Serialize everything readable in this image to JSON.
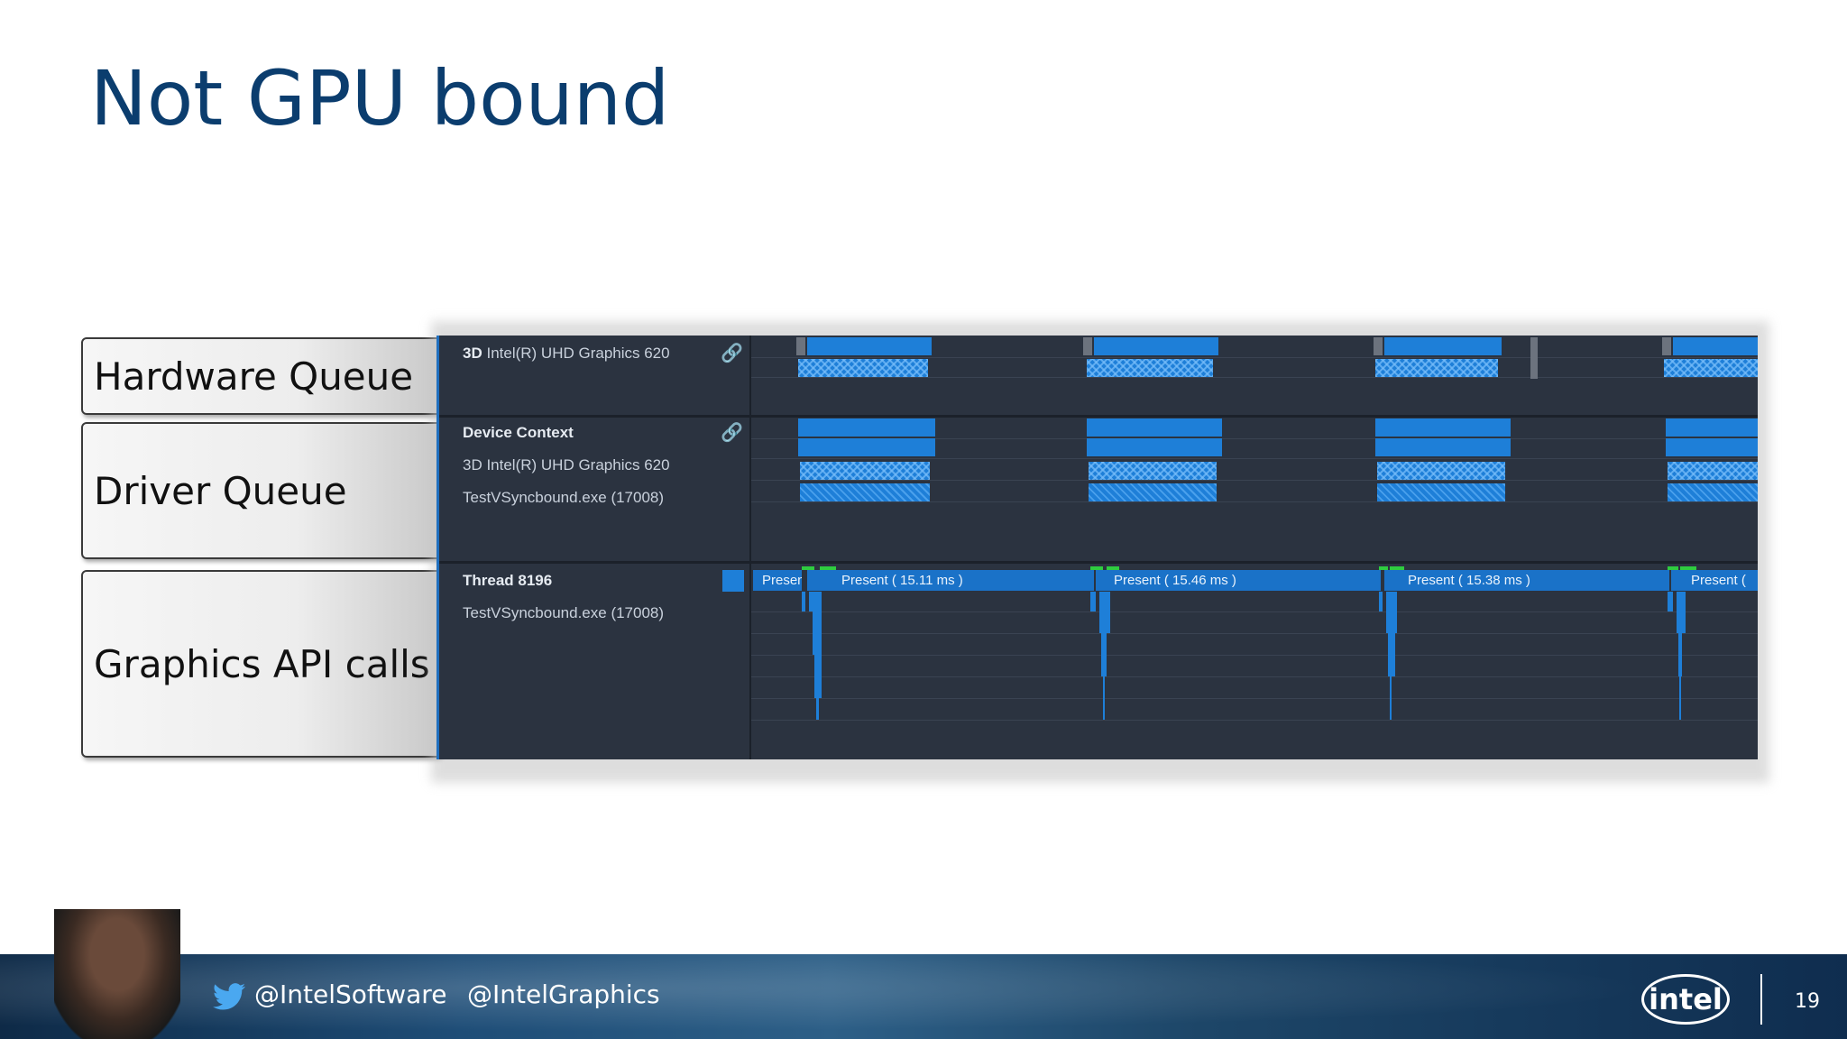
{
  "slide": {
    "title": "Not GPU bound",
    "page_number": "19"
  },
  "labels": {
    "hardware_queue": "Hardware Queue",
    "driver_queue": "Driver Queue",
    "api_calls": "Graphics API calls"
  },
  "panel": {
    "hw": {
      "prefix": "3D",
      "name": "Intel(R) UHD Graphics 620",
      "icon": "link-icon"
    },
    "driver": {
      "title": "Device Context",
      "line2": "3D Intel(R) UHD Graphics 620",
      "line3": "TestVSyncbound.exe (17008)",
      "icon": "link-icon"
    },
    "thread": {
      "title": "Thread 8196",
      "process": "TestVSyncbound.exe (17008)",
      "presents": [
        "Presen",
        "Present ( 15.11 ms )",
        "Present ( 15.46 ms )",
        "Present ( 15.38 ms )",
        "Present ("
      ]
    }
  },
  "footer": {
    "twitter_icon": "twitter-bird-icon",
    "handle1": "@IntelSoftware",
    "handle2": "@IntelGraphics",
    "logo": "intel"
  },
  "colors": {
    "title": "#0b3d6e",
    "panel_bg": "#2b3340",
    "bar": "#1e7fd8"
  }
}
